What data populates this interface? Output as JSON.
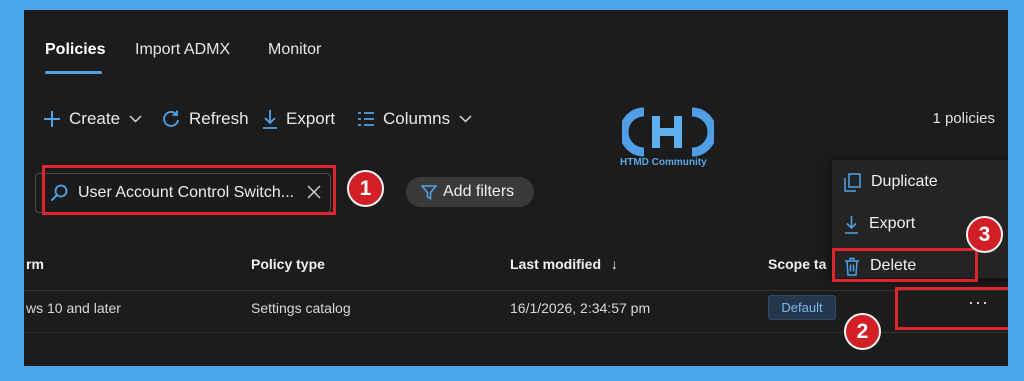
{
  "tabs": [
    {
      "label": "Policies",
      "active": true
    },
    {
      "label": "Import ADMX",
      "active": false
    },
    {
      "label": "Monitor",
      "active": false
    }
  ],
  "toolbar": {
    "create": "Create",
    "refresh": "Refresh",
    "export": "Export",
    "columns": "Columns",
    "count": "1 policies"
  },
  "logo": {
    "text": "HTMD Community"
  },
  "search": {
    "value": "User Account Control Switch..."
  },
  "filters": {
    "label": "Add filters"
  },
  "table": {
    "headers": [
      "rm",
      "Policy type",
      "Last modified",
      "Scope ta"
    ],
    "sort_indicator": "↓",
    "rows": [
      {
        "platform": "ws 10 and later",
        "policy_type": "Settings catalog",
        "last_modified": "16/1/2026, 2:34:57 pm",
        "scope_tag": "Default",
        "more": "···"
      }
    ]
  },
  "context_menu": {
    "items": [
      {
        "label": "Duplicate",
        "icon": "duplicate-icon"
      },
      {
        "label": "Export",
        "icon": "download-icon"
      },
      {
        "label": "Delete",
        "icon": "trash-icon"
      }
    ]
  },
  "callouts": [
    "1",
    "2",
    "3"
  ],
  "colors": {
    "accent": "#4fa3e8",
    "callout_red": "#d21f26",
    "background_frame": "#4aa8ea",
    "panel": "#1c1c1c"
  }
}
